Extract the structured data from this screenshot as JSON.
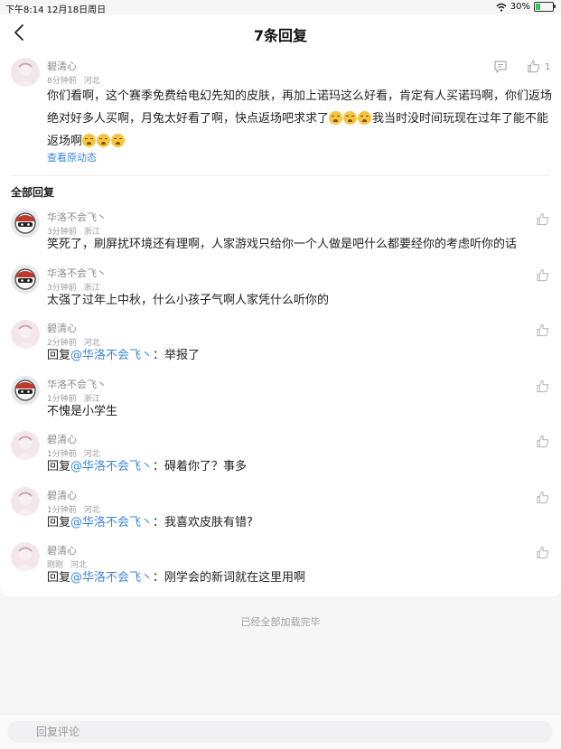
{
  "status_bar": {
    "time_date": "下午8:14  12月18日周日",
    "battery": "30%",
    "battery_level": 0.3
  },
  "header": {
    "title": "7条回复"
  },
  "main_comment": {
    "user": "碧清心",
    "time": "8分钟前",
    "location": "河北",
    "likes": "1",
    "text_line1": "你们看啊，这个赛季免费给电幻先知的皮肤，再加上诺玛这么好看，肯定有人买诺玛啊，你们返场",
    "text_line2_a": "绝对好多人买啊，月兔太好看了啊，快点返场吧求求了",
    "text_line2_b": "我当时没时间玩现在过年了能不能",
    "text_line3": "返场啊",
    "view_original": "查看原动态"
  },
  "section_title": "全部回复",
  "replies": [
    {
      "user": "华洛不会飞丶",
      "time": "3分钟前",
      "location": "浙江",
      "prefix": "",
      "mention": "",
      "text": "笑死了，刷屏扰环境还有理啊，人家游戏只给你一个人做是吧什么都要经你的考虑听你的话"
    },
    {
      "user": "华洛不会飞丶",
      "time": "3分钟前",
      "location": "浙江",
      "prefix": "",
      "mention": "",
      "text": "太强了过年上中秋，什么小孩子气啊人家凭什么听你的"
    },
    {
      "user": "碧清心",
      "time": "2分钟前",
      "location": "河北",
      "prefix": "回复",
      "mention": "@华洛不会飞丶",
      "text": "：举报了"
    },
    {
      "user": "华洛不会飞丶",
      "time": "1分钟前",
      "location": "浙江",
      "prefix": "",
      "mention": "",
      "text": "不愧是小学生"
    },
    {
      "user": "碧清心",
      "time": "1分钟前",
      "location": "河北",
      "prefix": "回复",
      "mention": "@华洛不会飞丶",
      "text": "：碍着你了？事多"
    },
    {
      "user": "碧清心",
      "time": "1分钟前",
      "location": "河北",
      "prefix": "回复",
      "mention": "@华洛不会飞丶",
      "text": "：我喜欢皮肤有错?"
    },
    {
      "user": "碧清心",
      "time": "刚刚",
      "location": "河北",
      "prefix": "回复",
      "mention": "@华洛不会飞丶",
      "text": "：刚学会的新词就在这里用啊"
    }
  ],
  "loaded_all": "已经全部加载完毕",
  "reply_placeholder": "回复评论",
  "colors": {
    "mention": "#3a86d9",
    "battery": "#35c759"
  },
  "icons": [
    "back-arrow-icon",
    "comment-icon",
    "thumbs-up-icon",
    "wifi-icon",
    "battery-icon"
  ]
}
